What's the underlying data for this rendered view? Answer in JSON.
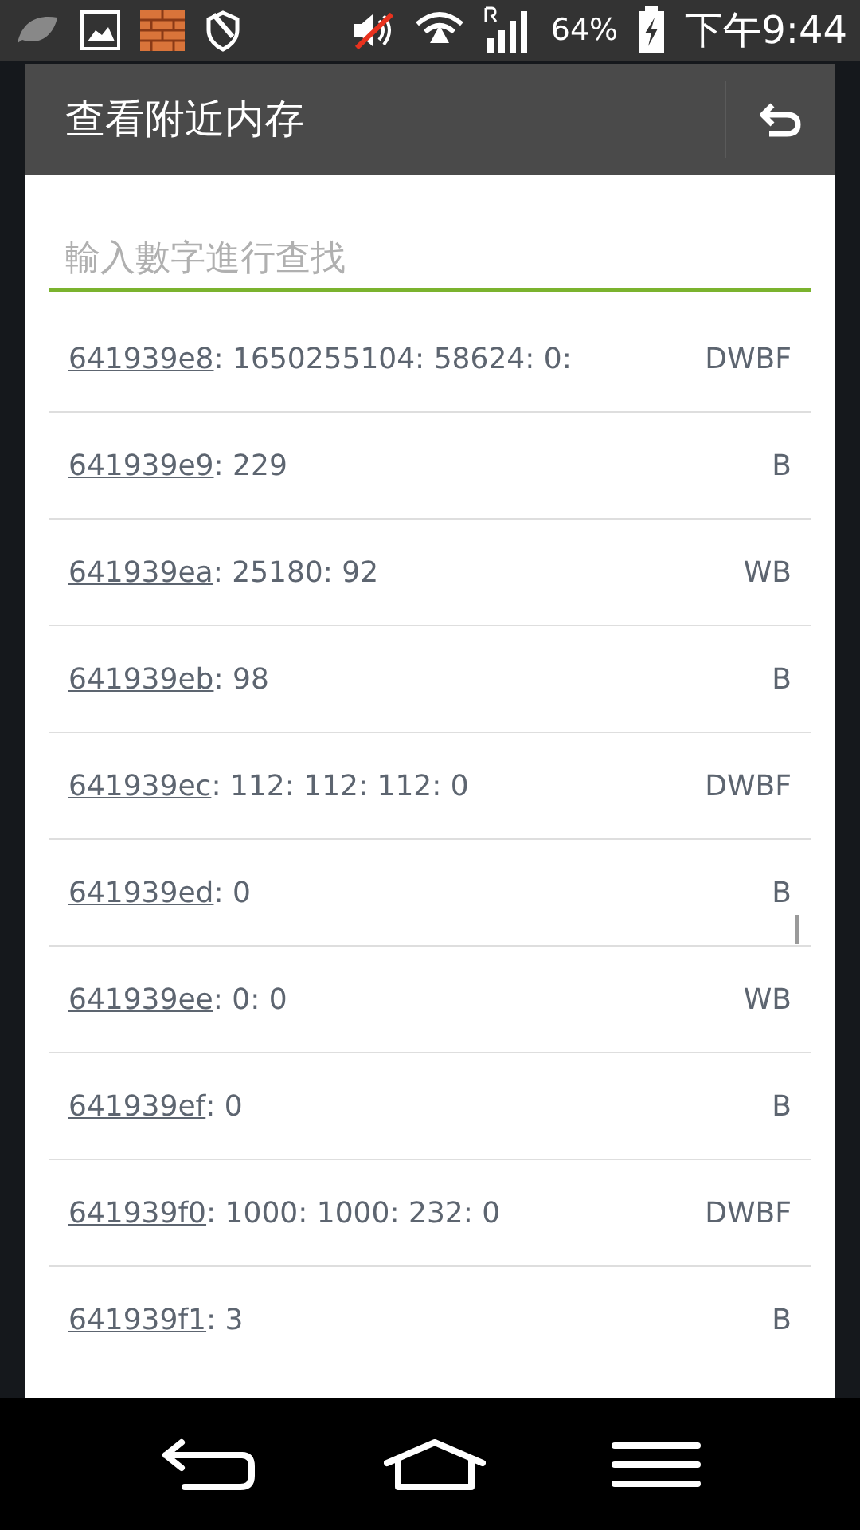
{
  "status_bar": {
    "battery": "64%",
    "time": "下午9:44"
  },
  "dialog": {
    "title": "查看附近内存",
    "search": {
      "placeholder": "輸入數字進行查找"
    },
    "rows": [
      {
        "address": "641939e8",
        "values": ": 1650255104: 58624: 0:",
        "type": "DWBF"
      },
      {
        "address": "641939e9",
        "values": ": 229",
        "type": "B"
      },
      {
        "address": "641939ea",
        "values": ": 25180: 92",
        "type": "WB"
      },
      {
        "address": "641939eb",
        "values": ": 98",
        "type": "B"
      },
      {
        "address": "641939ec",
        "values": ": 112: 112: 112: 0",
        "type": "DWBF"
      },
      {
        "address": "641939ed",
        "values": ": 0",
        "type": "B"
      },
      {
        "address": "641939ee",
        "values": ": 0: 0",
        "type": "WB"
      },
      {
        "address": "641939ef",
        "values": ": 0",
        "type": "B"
      },
      {
        "address": "641939f0",
        "values": ": 1000: 1000: 232: 0",
        "type": "DWBF"
      },
      {
        "address": "641939f1",
        "values": ": 3",
        "type": "B"
      }
    ]
  }
}
